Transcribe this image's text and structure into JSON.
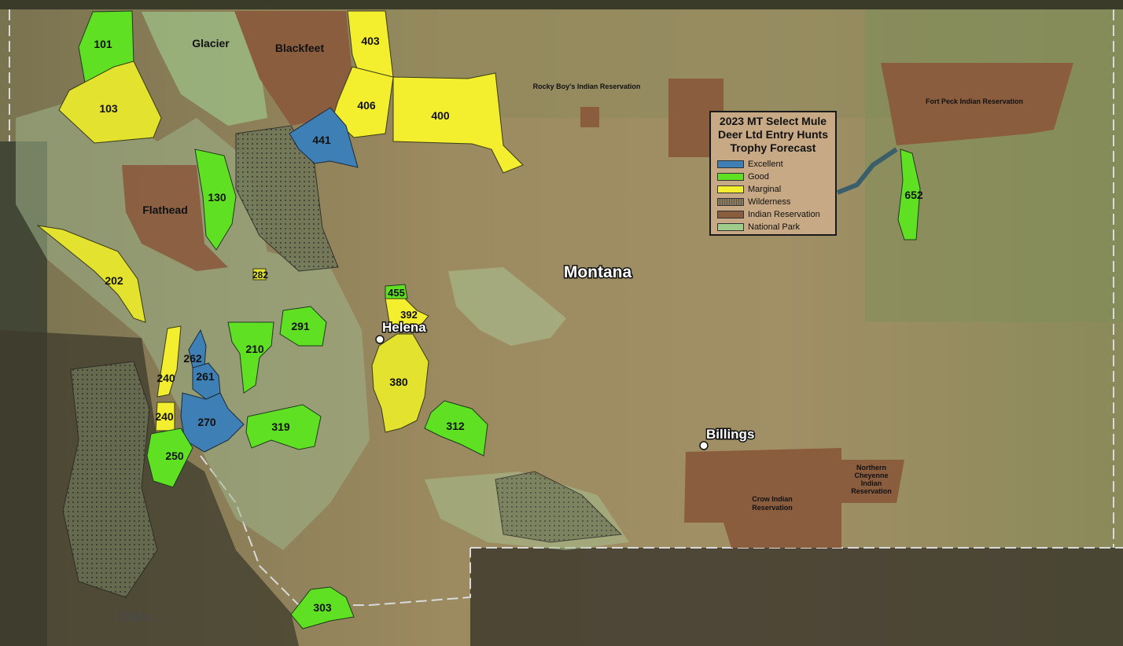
{
  "legend": {
    "title_lines": [
      "2023 MT Select Mule",
      "Deer Ltd Entry Hunts",
      "Trophy Forecast"
    ],
    "items": [
      {
        "label": "Excellent",
        "color": "#3e7fb5"
      },
      {
        "label": "Good",
        "color": "#5fe022"
      },
      {
        "label": "Marginal",
        "color": "#f3ee2e"
      },
      {
        "label": "Wilderness",
        "color": "#8a7d63"
      },
      {
        "label": "Indian Reservation",
        "color": "#8b5d3f"
      },
      {
        "label": "National Park",
        "color": "#9fcc8a"
      }
    ]
  },
  "places": {
    "state": "Montana",
    "neighbor_state": "Idaho",
    "cities": [
      "Helena",
      "Billings"
    ],
    "glacier": "Glacier",
    "blackfeet": "Blackfeet",
    "flathead": "Flathead",
    "rocky_boy": "Rocky Boy's Indian Reservation",
    "fort_peck": "Fort Peck Indian Reservation",
    "crow": [
      "Crow Indian",
      "Reservation"
    ],
    "northern_cheyenne": [
      "Northern",
      "Cheyenne",
      "Indian",
      "Reservation"
    ]
  },
  "districts": {
    "d101": "101",
    "d103": "103",
    "d403": "403",
    "d406": "406",
    "d400": "400",
    "d441": "441",
    "d130": "130",
    "d202": "202",
    "d282": "282",
    "d455": "455",
    "d392": "392",
    "d291": "291",
    "d210": "210",
    "d262": "262",
    "d261": "261",
    "d240a": "240",
    "d240b": "240",
    "d270": "270",
    "d250": "250",
    "d319": "319",
    "d380": "380",
    "d312": "312",
    "d303": "303",
    "d652": "652"
  }
}
